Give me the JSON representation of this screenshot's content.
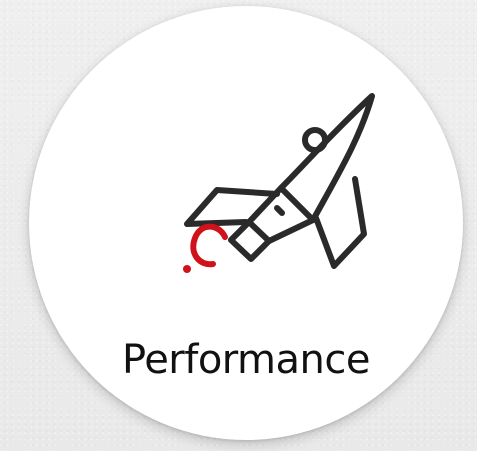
{
  "card": {
    "title": "Performance",
    "icon": "rocket-icon",
    "accent_color": "#d0121b",
    "text_color": "#111111",
    "background_color": "#ececec"
  }
}
